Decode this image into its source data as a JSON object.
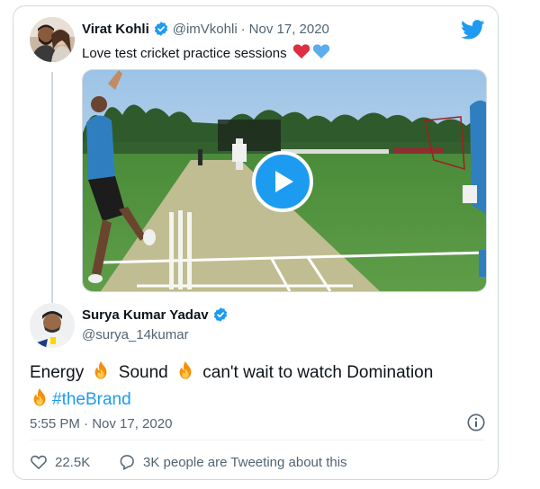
{
  "quoted_tweet": {
    "name": "Virat Kohli",
    "handle": "@imVkohli",
    "separator": "·",
    "date": "Nov 17, 2020",
    "text": "Love test cricket practice sessions",
    "emojis": [
      "red-heart",
      "blue-heart"
    ],
    "media_type": "video"
  },
  "main_tweet": {
    "name": "Surya Kumar Yadav",
    "handle": "@surya_14kumar",
    "text_parts": {
      "part1": "Energy",
      "part2": "Sound",
      "part3": "can't wait to watch Domination",
      "hashtag": "#theBrand"
    },
    "timestamp": "5:55 PM · Nov 17, 2020"
  },
  "actions": {
    "likes": "22.5K",
    "conversation": "3K people are Tweeting about this"
  },
  "colors": {
    "brand": "#1d9bf0",
    "text": "#0f1419",
    "secondary": "#536471",
    "border": "#cfd9de"
  },
  "icons": [
    "twitter-bird-icon",
    "verified-badge-icon",
    "play-icon",
    "fire-emoji",
    "info-icon",
    "heart-outline-icon",
    "reply-bubble-icon"
  ]
}
